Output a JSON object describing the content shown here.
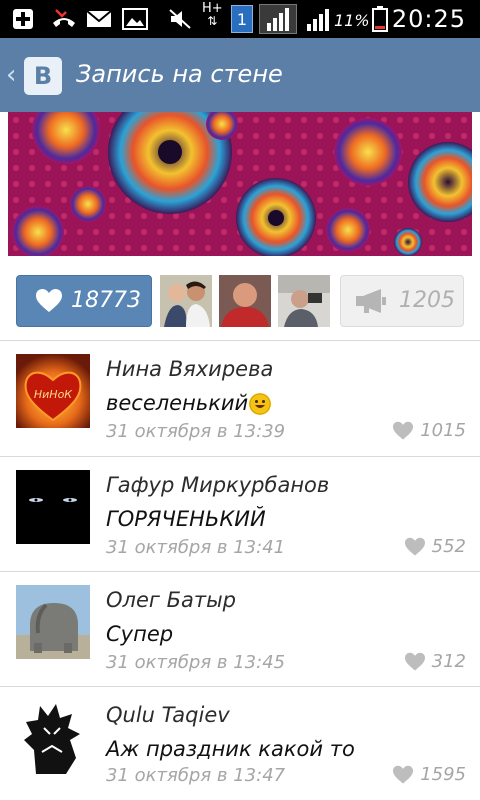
{
  "status_bar": {
    "time": "20:25",
    "battery_percent": "11%",
    "notification_badge": "1",
    "network_label": "H+",
    "icons": [
      "plus-icon",
      "missed-call-icon",
      "mail-icon",
      "image-icon",
      "mute-icon",
      "data-transfer-icon",
      "signal-icon",
      "battery-icon"
    ]
  },
  "header": {
    "back_icon": "chevron-left-icon",
    "logo": "vk-logo",
    "logo_letter": "В",
    "title": "Запись на стене",
    "color": "#5b7fa6"
  },
  "actions": {
    "like_count": "18773",
    "share_count": "1205",
    "like_color": "#5a86b6"
  },
  "comments": [
    {
      "name": "Нина Вяхирева",
      "text": "веселенький",
      "has_emoji": true,
      "date": "31 октября в 13:39",
      "likes": "1015",
      "avatar_text": "НиНоК"
    },
    {
      "name": "Гафур Миркурбанов",
      "text": "ГОРЯЧЕНЬКИЙ",
      "has_emoji": false,
      "date": "31 октября в 13:41",
      "likes": "552"
    },
    {
      "name": "Олег Батыр",
      "text": "Супер",
      "has_emoji": false,
      "date": "31 октября в 13:45",
      "likes": "312"
    },
    {
      "name": "Qulu Taqiev",
      "text": "Аж праздник какой то",
      "has_emoji": false,
      "date": "31 октября в 13:47",
      "likes": "1595"
    }
  ]
}
